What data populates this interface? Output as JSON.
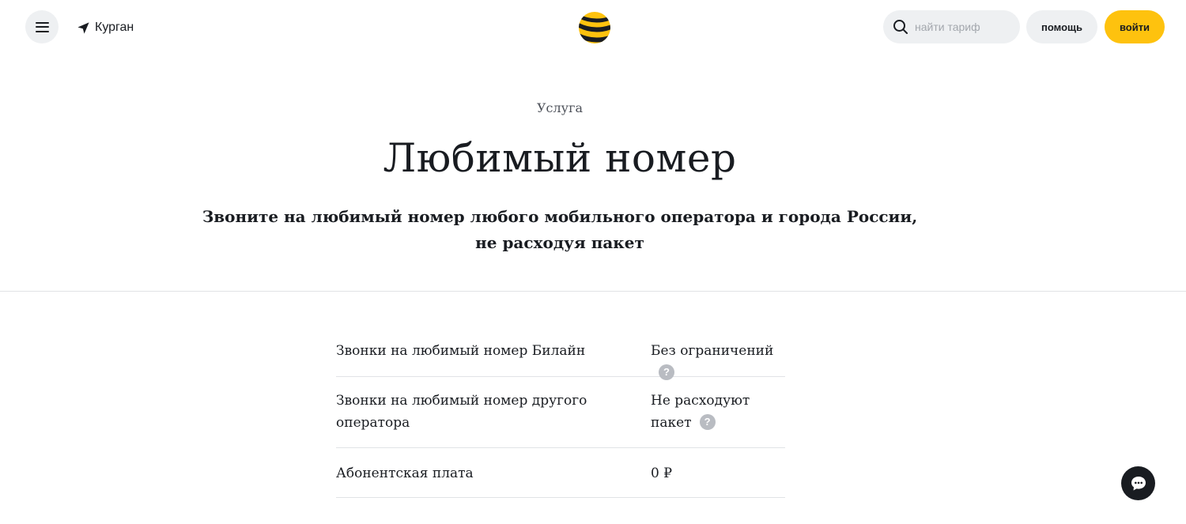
{
  "header": {
    "menu_icon": "hamburger-icon",
    "city_icon": "location-arrow-icon",
    "city": "Курган",
    "logo": "beeline-logo",
    "search_icon": "search-icon",
    "search_placeholder": "найти тариф",
    "help_label": "помощь",
    "login_label": "войти"
  },
  "hero": {
    "eyebrow": "Услуга",
    "title": "Любимый номер",
    "subtitle_line1": "Звоните на любимый номер любого мобильного оператора и города России,",
    "subtitle_line2": "не расходуя пакет"
  },
  "params": [
    {
      "key": "Звонки на любимый номер Билайн",
      "value": "Без ограничений",
      "hint": true
    },
    {
      "key_line1": "Звонки на любимый номер другого",
      "key_line2": "оператора",
      "value_line1": "Не расходуют",
      "value_line2": "пакет",
      "hint": true
    },
    {
      "key": "Абонентская плата",
      "value": "0 ₽",
      "hint": false
    }
  ],
  "hint_glyph": "?",
  "chat_icon": "chat-bubble-icon",
  "colors": {
    "accent": "#fec20e",
    "text": "#191c21",
    "button_bg": "#eef0f2",
    "divider": "#e1e3e6"
  }
}
